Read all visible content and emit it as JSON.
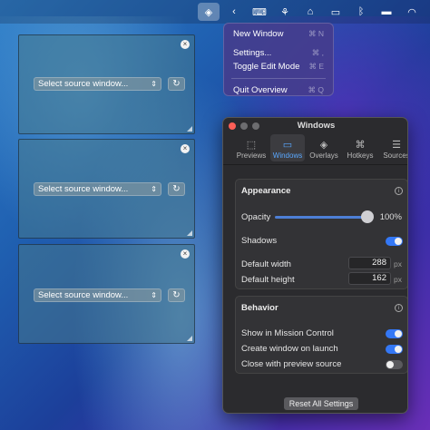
{
  "menubar": {
    "icons": [
      "layers-icon",
      "chevron-left-icon",
      "keyboard-icon",
      "handshake-icon",
      "bed-icon",
      "display-icon",
      "bluetooth-icon",
      "battery-icon",
      "wifi-icon"
    ]
  },
  "menu": {
    "items": [
      {
        "label": "New Window",
        "shortcut": "⌘ N"
      },
      {
        "label": "Settings...",
        "shortcut": "⌘ ,"
      },
      {
        "label": "Toggle Edit Mode",
        "shortcut": "⌘ E"
      },
      {
        "label": "Quit Overview",
        "shortcut": "⌘ Q"
      }
    ]
  },
  "overlays": [
    {
      "select_label": "Select source window..."
    },
    {
      "select_label": "Select source window..."
    },
    {
      "select_label": "Select source window..."
    }
  ],
  "settings": {
    "title": "Windows",
    "tabs": [
      {
        "label": "Previews"
      },
      {
        "label": "Windows"
      },
      {
        "label": "Overlays"
      },
      {
        "label": "Hotkeys"
      },
      {
        "label": "Sources"
      }
    ],
    "appearance": {
      "title": "Appearance",
      "opacity_label": "Opacity",
      "opacity_value": "100%",
      "opacity_fraction": 1.0,
      "shadows_label": "Shadows",
      "shadows_on": true,
      "width_label": "Default width",
      "width_value": "288",
      "height_label": "Default height",
      "height_value": "162",
      "unit": "px"
    },
    "behavior": {
      "title": "Behavior",
      "mission_label": "Show in Mission Control",
      "mission_on": true,
      "launch_label": "Create window on launch",
      "launch_on": true,
      "close_label": "Close with preview source",
      "close_on": false
    },
    "reset_label": "Reset All Settings"
  },
  "colors": {
    "accent": "#3478f6",
    "window_bg": "#2b2b2e",
    "close_red": "#ff5f57"
  }
}
